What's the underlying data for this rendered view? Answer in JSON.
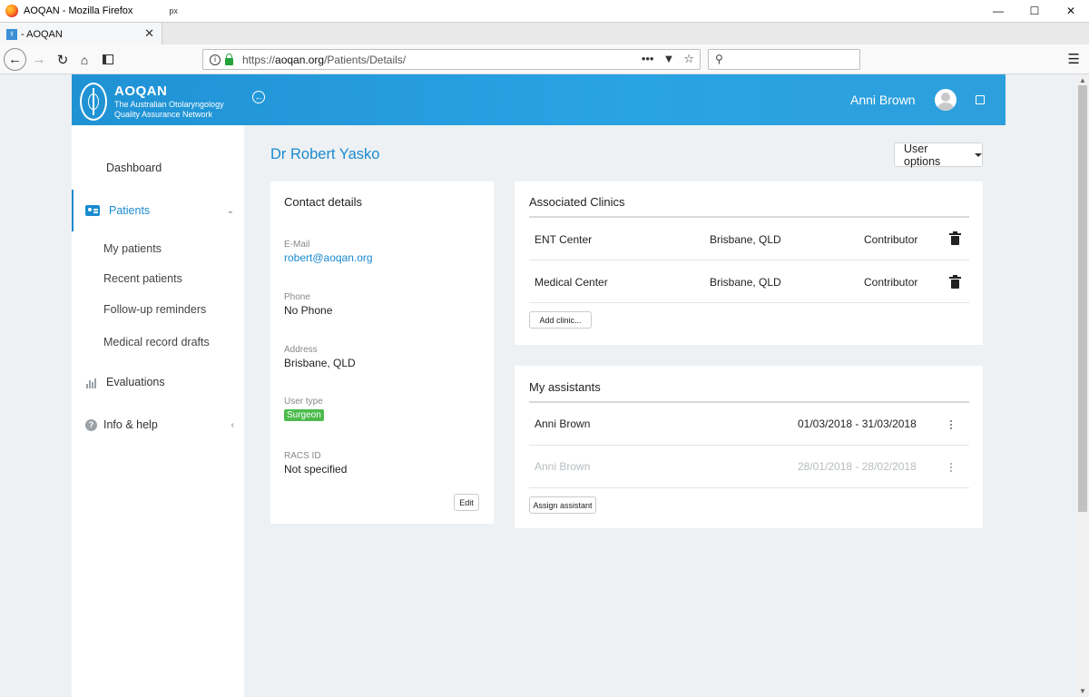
{
  "browser": {
    "window_title": "AOQAN - Mozilla Firefox",
    "stray_text": "px",
    "tab_label": "- AOQAN",
    "url_prefix": "https://",
    "url_host": "aoqan.org",
    "url_path": "/Patients/Details/",
    "url_actions_icon": "•••"
  },
  "header": {
    "brand_title": "AOQAN",
    "brand_subtitle_line1": "The Australian Otolaryngology",
    "brand_subtitle_line2": "Quality Assurance Network",
    "user_name": "Anni Brown"
  },
  "sidebar": {
    "items": [
      {
        "label": "Dashboard",
        "icon": "dashboard-icon"
      },
      {
        "label": "Patients",
        "icon": "id-card-icon"
      },
      {
        "label": "Evaluations",
        "icon": "bar-chart-icon"
      },
      {
        "label": "Info & help",
        "icon": "help-icon"
      }
    ],
    "patients_subitems": [
      "My patients",
      "Recent patients",
      "Follow-up reminders",
      "Medical record drafts"
    ]
  },
  "page": {
    "title": "Dr Robert Yasko",
    "user_options_label": "User options"
  },
  "contact": {
    "title": "Contact details",
    "email_label": "E-Mail",
    "email": "robert@aoqan.org",
    "phone_label": "Phone",
    "phone": "No Phone",
    "address_label": "Address",
    "address": "Brisbane, QLD",
    "user_type_label": "User type",
    "user_type": "Surgeon",
    "racs_label": "RACS ID",
    "racs": "Not specified",
    "edit_label": "Edit"
  },
  "clinics": {
    "title": "Associated Clinics",
    "rows": [
      {
        "name": "ENT Center",
        "location": "Brisbane, QLD",
        "role": "Contributor"
      },
      {
        "name": "Medical Center",
        "location": "Brisbane, QLD",
        "role": "Contributor"
      }
    ],
    "add_label": "Add clinic..."
  },
  "assistants": {
    "title": "My assistants",
    "rows": [
      {
        "name": "Anni Brown",
        "period": "01/03/2018 - 31/03/2018",
        "active": true
      },
      {
        "name": "Anni Brown",
        "period": "28/01/2018 - 28/02/2018",
        "active": false
      }
    ],
    "assign_label": "Assign assistant"
  },
  "colors": {
    "accent": "#1a8ad0",
    "header_gradient_start": "#1f92d4",
    "header_gradient_end": "#2d9fdc",
    "surgeon_badge": "#4cbb4c",
    "page_background": "#eef1f3"
  }
}
